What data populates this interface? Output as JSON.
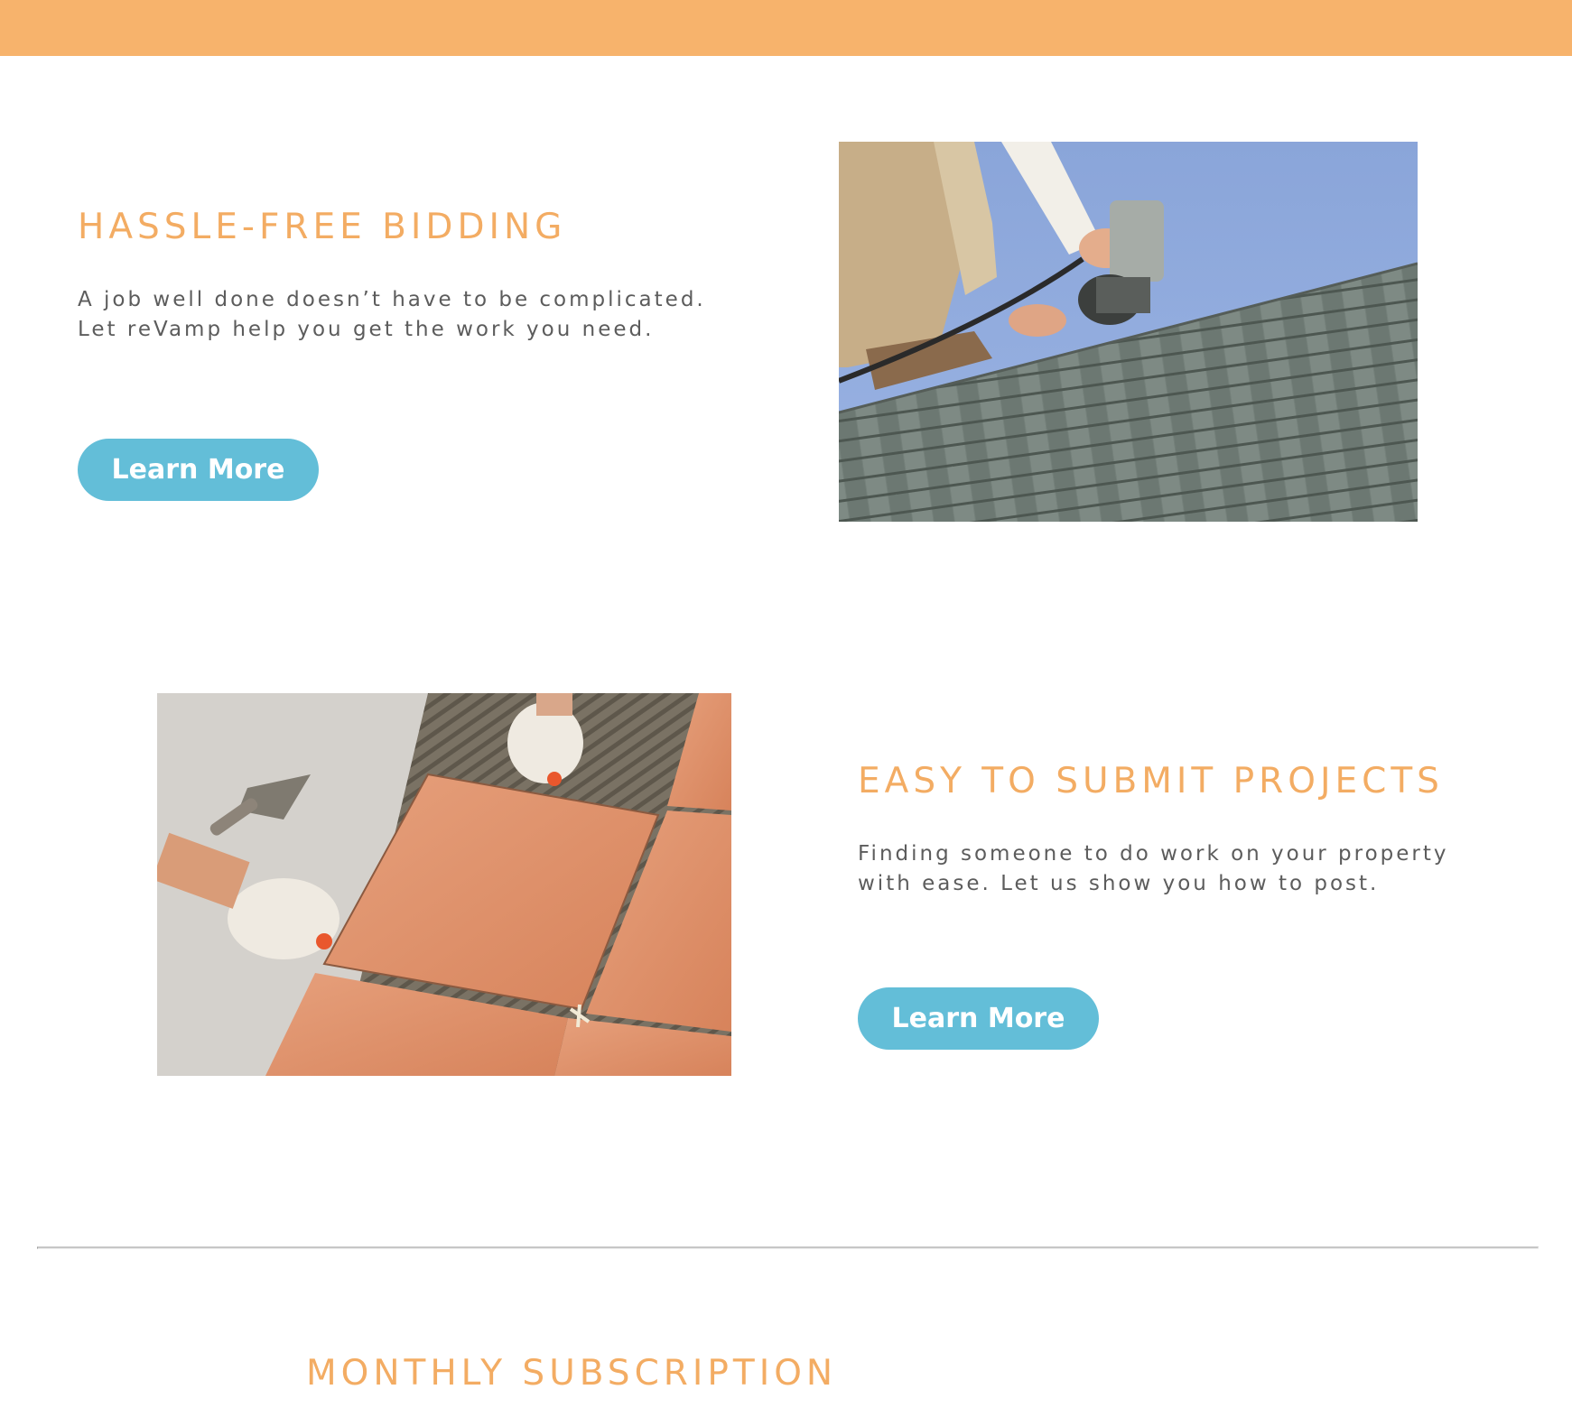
{
  "colors": {
    "accent_orange": "#f7b36c",
    "heading_orange": "#f3ac63",
    "button_blue": "#63bed8",
    "body_text": "#5c5c5c",
    "divider": "#c6c6c6"
  },
  "features": [
    {
      "title": "HASSLE-FREE BIDDING",
      "text": "A job well done doesn’t have to be complicated. Let reVamp help you get the work you need.",
      "button_label": "Learn More",
      "image_subject": "roofer using nail gun on shingle roof"
    },
    {
      "title": "EASY TO SUBMIT PROJECTS",
      "text": "Finding someone to do work on your property with ease. Let us show you how to post.",
      "button_label": "Learn More",
      "image_subject": "gloved hands laying terracotta floor tiles"
    }
  ],
  "subscription": {
    "title": "MONTHLY SUBSCRIPTION"
  }
}
